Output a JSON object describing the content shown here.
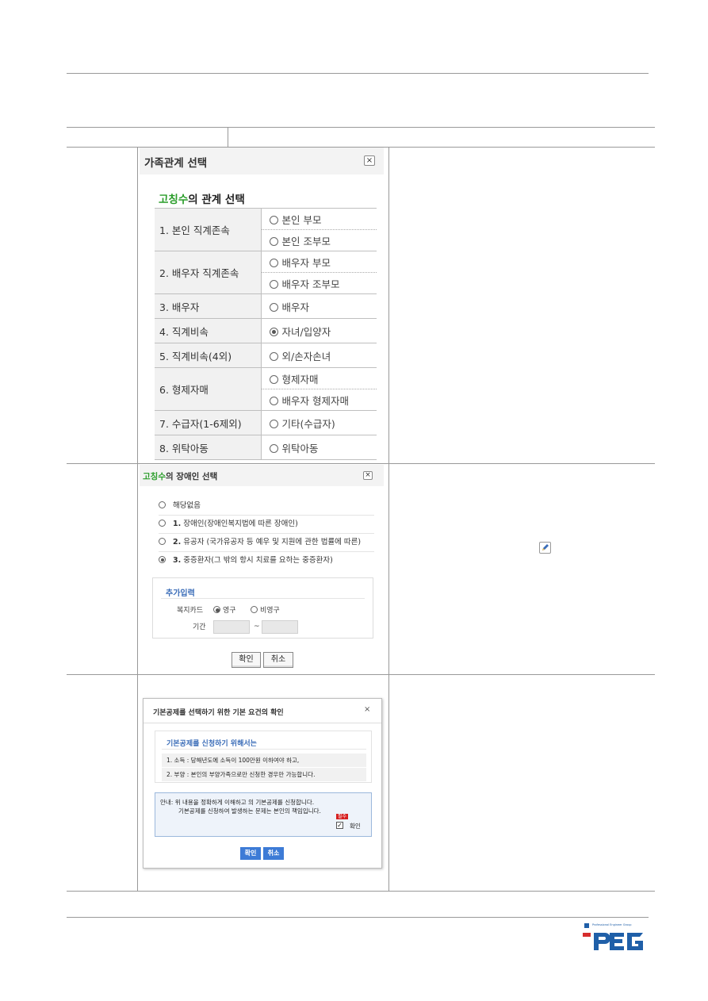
{
  "panel_relationship": {
    "title": "가족관계 선택",
    "close": "×",
    "subtitle_name": "고칭수",
    "subtitle_rest": "의 관계 선택",
    "rows": [
      {
        "label": "1. 본인 직계존속",
        "options": [
          "본인 부모",
          "본인 조부모"
        ]
      },
      {
        "label": "2. 배우자 직계존속",
        "options": [
          "배우자 부모",
          "배우자 조부모"
        ]
      },
      {
        "label": "3. 배우자",
        "options": [
          "배우자"
        ]
      },
      {
        "label": "4. 직계비속",
        "options": [
          "자녀/입양자"
        ]
      },
      {
        "label": "5. 직계비속(4외)",
        "options": [
          "외/손자손녀"
        ]
      },
      {
        "label": "6. 형제자매",
        "options": [
          "형제자매",
          "배우자 형제자매"
        ]
      },
      {
        "label": "7. 수급자(1-6제외)",
        "options": [
          "기타(수급자)"
        ]
      },
      {
        "label": "8. 위탁아동",
        "options": [
          "위탁아동"
        ]
      }
    ],
    "selected": "자녀/입양자"
  },
  "panel_disability": {
    "title_name": "고칭수",
    "title_rest": "의 장애인 선택",
    "close": "×",
    "options": [
      {
        "num": "",
        "text": "해당없음"
      },
      {
        "num": "1.",
        "text": "장애인(장애인복지법에 따른 장애인)"
      },
      {
        "num": "2.",
        "text": "유공자 (국가유공자 등 예우 및 지원에 관한 법률에 따른)"
      },
      {
        "num": "3.",
        "text": "중증환자(그 밖의 항시 치료를 요하는 중증환자)"
      }
    ],
    "selected_index": 3,
    "extra_title": "추가입력",
    "welfare_card_label": "복지카드",
    "welfare_card_options": [
      "영구",
      "비영구"
    ],
    "welfare_card_selected": "영구",
    "period_label": "기간",
    "period_sep": "~",
    "confirm": "확인",
    "cancel": "취소"
  },
  "panel_basic": {
    "title": "기본공제를 선택하기 위한 기본 요건의 확인",
    "close": "×",
    "box_title": "기본공제를 신청하기 위해서는",
    "lines": [
      "1. 소득 : 당해년도에 소득이 100만원 이하여야 하고,",
      "2. 부양 : 본인의 부양가족으로만 신청한 경우만 가능합니다."
    ],
    "guide_line1": "안내: 위 내용을 정확하게 이해하고 의 기본공제를 신청합니다.",
    "guide_line2": "기본공제를 신청하여 발생하는 문제는 본인의 책임입니다.",
    "required_badge": "필수",
    "check_label": "확인",
    "checked": true,
    "confirm": "확인",
    "cancel": "취소"
  },
  "logo": {
    "text": "PEG",
    "tagline": "Professional Engineer Group",
    "brand_color": "#1f5fa8"
  }
}
